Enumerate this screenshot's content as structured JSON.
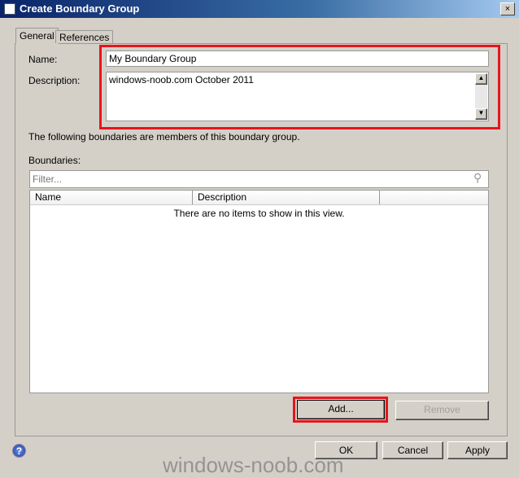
{
  "window": {
    "title": "Create Boundary Group",
    "close": "×"
  },
  "tabs": [
    {
      "label": "General",
      "active": true
    },
    {
      "label": "References",
      "active": false
    }
  ],
  "form": {
    "name_label": "Name:",
    "name_value": "My Boundary Group",
    "description_label": "Description:",
    "description_value": "windows-noob.com October 2011"
  },
  "info_text": "The following boundaries are members of this boundary group.",
  "boundaries": {
    "label": "Boundaries:",
    "filter_placeholder": "Filter...",
    "columns": [
      "Name",
      "Description",
      ""
    ],
    "empty_text": "There are no items to show in this view.",
    "add": "Add...",
    "remove": "Remove"
  },
  "footer": {
    "ok": "OK",
    "cancel": "Cancel",
    "apply": "Apply"
  },
  "watermark": "windows-noob.com",
  "colors": {
    "highlight": "#e8141c",
    "title_bar": "#0a246a"
  }
}
